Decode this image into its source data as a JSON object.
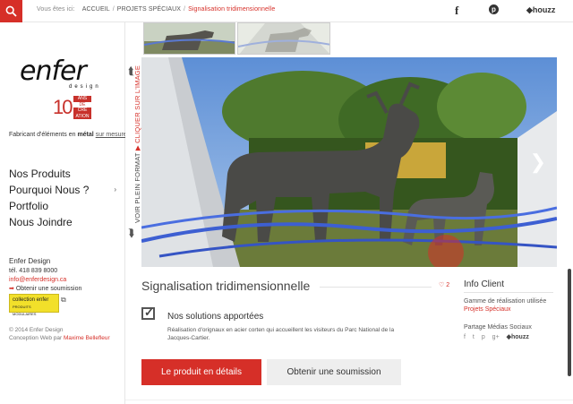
{
  "breadcrumb": {
    "prefix": "Vous êtes ici:",
    "home": "ACCUEIL",
    "category": "PROJETS SPÉCIAUX",
    "current": "Signalisation tridimensionnelle"
  },
  "social_top": {
    "facebook": "f",
    "pinterest": "p",
    "houzz": "houzz"
  },
  "brand": {
    "logo_word": "enfer",
    "logo_sub": "design",
    "years": "10",
    "years_stack": [
      "ANS",
      "DE",
      "CRÉ",
      "ATION"
    ],
    "tagline_pre": "Fabricant d'éléments en ",
    "tagline_bold": "métal",
    "tagline_link": "sur mesure"
  },
  "nav": {
    "items": [
      {
        "label": "Nos Produits"
      },
      {
        "label": "Pourquoi Nous ?"
      },
      {
        "label": "Portfolio"
      },
      {
        "label": "Nous Joindre"
      }
    ]
  },
  "contact": {
    "name": "Enfer Design",
    "phone": "tél. 418 839 8000",
    "email": "info@enferdesign.ca",
    "quote_link": "Obtenir une soumission"
  },
  "collection": {
    "label": "collection enfer",
    "sub": "PRODUITS MODULAIRES",
    "link_icon": "external-link-icon"
  },
  "footer": {
    "copyright": "© 2014 Enfer Design",
    "credit_pre": "Conception Web par ",
    "credit_name": "Maxime Bellefleur"
  },
  "vertical_tab": {
    "part1": "VOIR PLEIN FORMAT",
    "part2": "CLIQUER SUR L'IMAGE"
  },
  "project": {
    "title": "Signalisation tridimensionnelle",
    "likes": "2",
    "solutions_title": "Nos solutions apportées",
    "solutions_desc": "Réalisation d'orignaux en acier corten qui accueillent les visiteurs du Parc National de la Jacques-Cartier."
  },
  "buttons": {
    "details": "Le produit en détails",
    "quote": "Obtenir une soumission"
  },
  "info_client": {
    "title": "Info Client",
    "gamme_label": "Gamme de réalisation utilisée",
    "gamme_value": "Projets Spéciaux",
    "share_label": "Partage Médias Sociaux",
    "share_icons": [
      "f",
      "t",
      "p",
      "g+"
    ],
    "houzz": "houzz"
  },
  "colors": {
    "accent": "#d62f28",
    "text": "#333333",
    "button_secondary": "#eeeeee"
  }
}
